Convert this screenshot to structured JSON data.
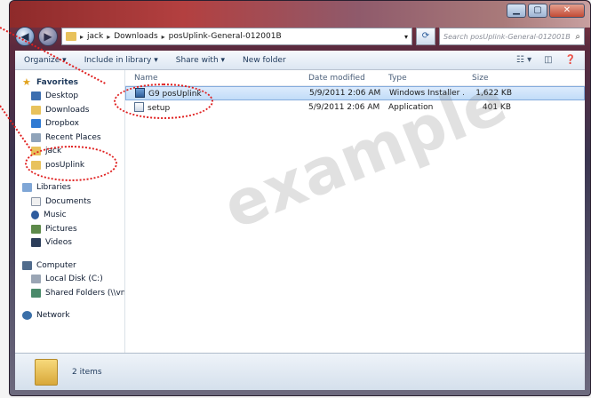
{
  "address": {
    "crumbs": [
      "jack",
      "Downloads",
      "posUplink-General-012001B"
    ]
  },
  "search": {
    "placeholder": "Search posUplink-General-012001B"
  },
  "toolbar": {
    "organize": "Organize ▾",
    "include": "Include in library ▾",
    "share": "Share with ▾",
    "new_folder": "New folder"
  },
  "nav": {
    "favorites": {
      "header": "Favorites",
      "items": [
        "Desktop",
        "Downloads",
        "Dropbox",
        "Recent Places",
        "jack",
        "posUplink"
      ]
    },
    "libraries": {
      "header": "Libraries",
      "items": [
        "Documents",
        "Music",
        "Pictures",
        "Videos"
      ]
    },
    "computer": {
      "header": "Computer",
      "items": [
        "Local Disk (C:)",
        "Shared Folders (\\\\vn"
      ]
    },
    "network": {
      "header": "Network"
    }
  },
  "columns": {
    "name": "Name",
    "date": "Date modified",
    "type": "Type",
    "size": "Size"
  },
  "files": [
    {
      "name": "G9 posUplink",
      "date": "5/9/2011 2:06 AM",
      "type": "Windows Installer ...",
      "size": "1,622 KB",
      "icon": "msi-icon"
    },
    {
      "name": "setup",
      "date": "5/9/2011 2:06 AM",
      "type": "Application",
      "size": "401 KB",
      "icon": "exe-icon"
    }
  ],
  "status": {
    "count": "2 items"
  },
  "watermark": "example",
  "colors": {
    "callout": "#e02020",
    "selection": "#c1dcf8",
    "title_red": "#b34040"
  }
}
